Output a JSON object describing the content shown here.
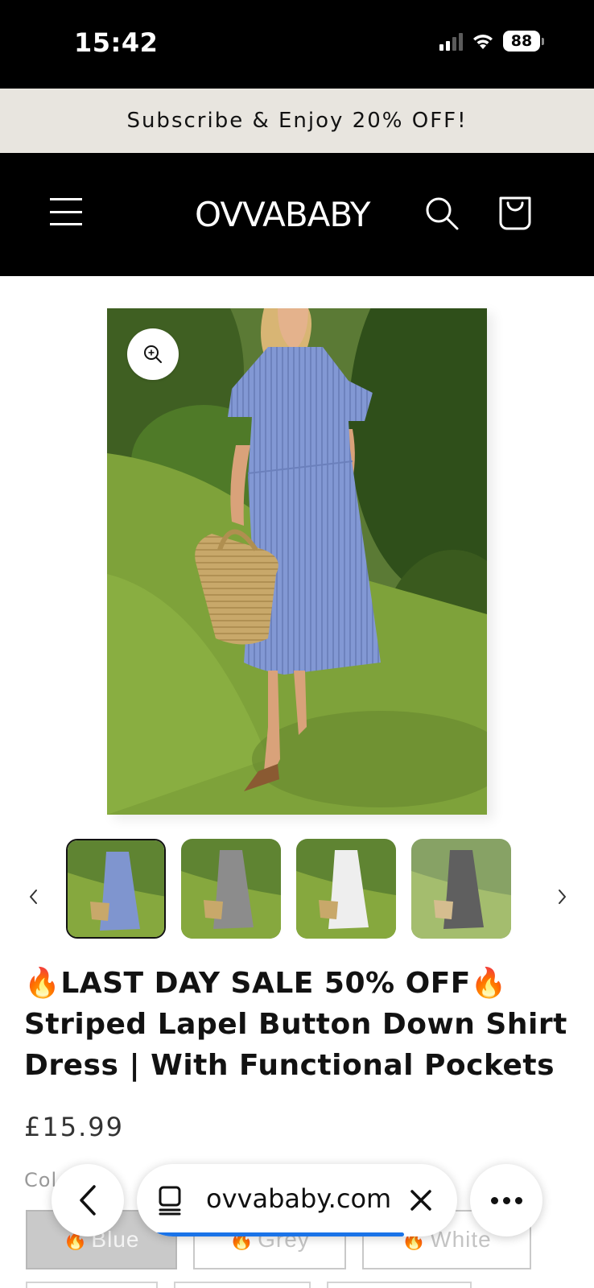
{
  "status_bar": {
    "time": "15:42",
    "battery": "88",
    "icons": [
      "signal-icon",
      "wifi-icon",
      "battery-icon"
    ]
  },
  "announcement": {
    "text": "Subscribe & Enjoy 20% OFF!"
  },
  "header": {
    "logo": "OVVABABY",
    "icons": [
      "menu-icon",
      "search-icon",
      "cart-icon"
    ]
  },
  "product": {
    "title_line1": "🔥LAST DAY SALE 50% OFF🔥",
    "title_line2": "Striped Lapel Button Down Shirt",
    "title_line3": "Dress | With Functional Pockets",
    "price": "£15.99",
    "color_label": "Col",
    "thumbnail_colors": [
      "#7f95cf",
      "#8c8c8c",
      "#eeeeee",
      "#2a2a2a"
    ],
    "variants": [
      {
        "name": "Blue",
        "selected": true
      },
      {
        "name": "Grey",
        "selected": false
      },
      {
        "name": "White",
        "selected": false
      }
    ]
  },
  "browser": {
    "url": "ovvababy.com",
    "load_progress": 0.8,
    "icons": [
      "chevron-left-icon",
      "tabs-icon",
      "close-icon",
      "more-icon"
    ]
  },
  "colors": {
    "header_bg": "#000000",
    "announcement_bg": "#e8e5df",
    "dress_blue": "#7f95cf",
    "accent_link": "#1a73e8"
  }
}
